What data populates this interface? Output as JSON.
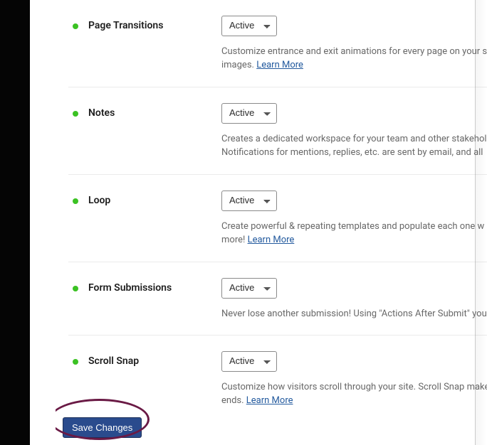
{
  "status_color": "#3bc223",
  "select_value": "Active",
  "rows": [
    {
      "label": "Page Transitions",
      "value": "Active",
      "desc_a": "Customize entrance and exit animations for every page on your s",
      "desc_b": "images. ",
      "learn": "Learn More"
    },
    {
      "label": "Notes",
      "value": "Active",
      "desc_a": "Creates a dedicated workspace for your team and other stakehol",
      "desc_b": "Notifications for mentions, replies, etc. are sent by email, and all ",
      "learn": ""
    },
    {
      "label": "Loop",
      "value": "Active",
      "desc_a": "Create powerful & repeating templates and populate each one w",
      "desc_b": "more! ",
      "learn": "Learn More"
    },
    {
      "label": "Form Submissions",
      "value": "Active",
      "desc_a": "Never lose another submission! Using \"Actions After Submit\" you",
      "desc_b": "",
      "learn": ""
    },
    {
      "label": "Scroll Snap",
      "value": "Active",
      "desc_a": "Customize how visitors scroll through your site. Scroll Snap make",
      "desc_b": "ends. ",
      "learn": "Learn More"
    }
  ],
  "save_label": "Save Changes"
}
